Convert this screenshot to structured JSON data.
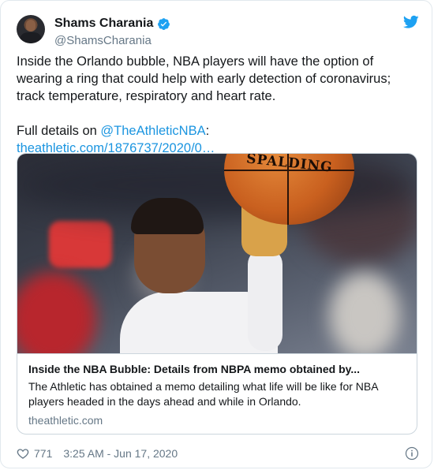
{
  "author": {
    "display_name": "Shams Charania",
    "handle": "@ShamsCharania"
  },
  "tweet": {
    "body": "Inside the Orlando bubble, NBA players will have the option of wearing a ring that could help with early detection of coronavirus; track temperature, respiratory and heart rate.",
    "details_prefix": "Full details on ",
    "mention": "@TheAthleticNBA",
    "colon": ":",
    "link": "theathletic.com/1876737/2020/0…"
  },
  "card": {
    "image_alt": "Player shooting a Spalding basketball",
    "ball_text": "SPALDING",
    "title": "Inside the NBA Bubble: Details from NBPA memo obtained by...",
    "description": "The Athletic has obtained a memo detailing what life will be like for NBA players headed in the days ahead and while in Orlando.",
    "domain": "theathletic.com"
  },
  "footer": {
    "likes": "771",
    "timestamp": "3:25 AM - Jun 17, 2020"
  },
  "icons": {
    "verified": "verified-badge-icon",
    "twitter": "twitter-bird-icon",
    "like": "heart-icon",
    "info": "info-icon"
  },
  "colors": {
    "link": "#1b95e0",
    "verified": "#1da1f2",
    "secondary_text": "#657786",
    "border": "#e1e8ed"
  }
}
